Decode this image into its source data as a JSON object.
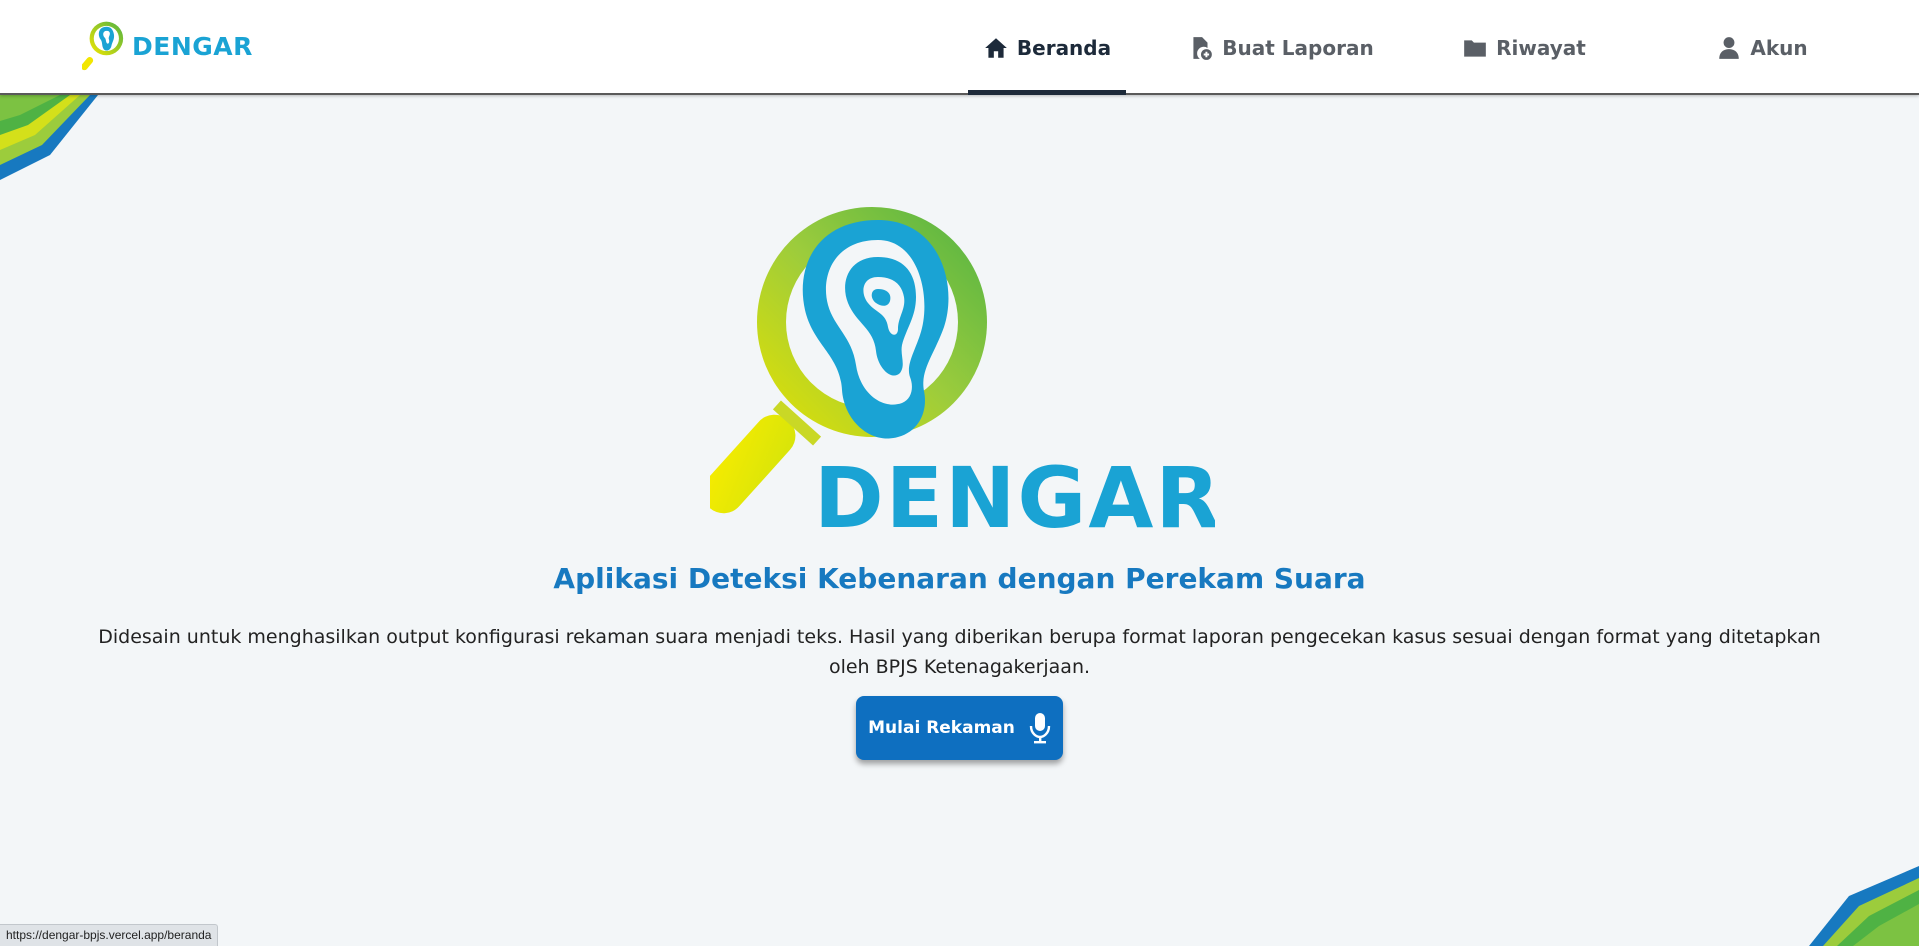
{
  "app": {
    "brand": "DENGAR"
  },
  "nav": {
    "items": [
      {
        "label": "Beranda",
        "icon": "home-icon",
        "active": true
      },
      {
        "label": "Buat Laporan",
        "icon": "file-add-icon",
        "active": false
      },
      {
        "label": "Riwayat",
        "icon": "folder-icon",
        "active": false
      },
      {
        "label": "Akun",
        "icon": "user-icon",
        "active": false
      }
    ]
  },
  "hero": {
    "logo_text": "DENGAR",
    "tagline": "Aplikasi Deteksi Kebenaran dengan Perekam Suara",
    "description": "Didesain untuk menghasilkan output konfigurasi rekaman suara menjadi teks. Hasil yang diberikan berupa format laporan pengecekan kasus sesuai dengan format yang ditetapkan oleh BPJS Ketenagakerjaan.",
    "button_label": "Mulai Rekaman",
    "button_icon": "microphone-icon"
  },
  "status_bar": {
    "url": "https://dengar-bpjs.vercel.app/beranda"
  },
  "colors": {
    "brand_blue": "#1aa3d4",
    "tagline_blue": "#1779c0",
    "button_blue": "#0e6fc0",
    "nav_active": "#1d2a3a",
    "logo_green": "#7cc242",
    "logo_yellow": "#f2e600"
  }
}
